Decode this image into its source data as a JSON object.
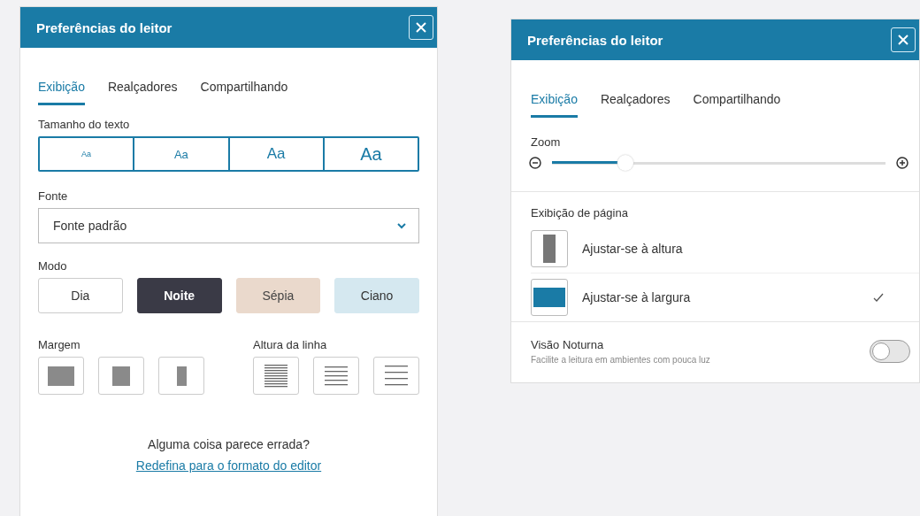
{
  "left_panel": {
    "title": "Preferências do leitor",
    "tabs": [
      {
        "label": "Exibição",
        "selected": true
      },
      {
        "label": "Realçadores",
        "selected": false
      },
      {
        "label": "Compartilhando",
        "selected": false
      }
    ],
    "text_size": {
      "label": "Tamanho do texto",
      "options": [
        {
          "label": "Aa"
        },
        {
          "label": "Aa"
        },
        {
          "label": "Aa"
        },
        {
          "label": "Aa"
        }
      ]
    },
    "font": {
      "label": "Fonte",
      "value": "Fonte padrão"
    },
    "mode": {
      "label": "Modo",
      "options": [
        {
          "label": "Dia",
          "kind": "day"
        },
        {
          "label": "Noite",
          "kind": "night"
        },
        {
          "label": "Sépia",
          "kind": "sepia"
        },
        {
          "label": "Ciano",
          "kind": "cyan"
        }
      ]
    },
    "margin": {
      "label": "Margem",
      "options": [
        {
          "kind": "wide"
        },
        {
          "kind": "medium"
        },
        {
          "kind": "narrow"
        }
      ]
    },
    "line_height": {
      "label": "Altura da linha",
      "options": [
        {
          "kind": "tight"
        },
        {
          "kind": "medium"
        },
        {
          "kind": "loose"
        }
      ]
    },
    "footer": {
      "question": "Alguma coisa parece errada?",
      "link": "Redefina para o formato do editor"
    }
  },
  "right_panel": {
    "title": "Preferências do leitor",
    "tabs": [
      {
        "label": "Exibição",
        "selected": true
      },
      {
        "label": "Realçadores",
        "selected": false
      },
      {
        "label": "Compartilhando",
        "selected": false
      }
    ],
    "zoom": {
      "label": "Zoom",
      "level": 0.22
    },
    "page_view": {
      "label": "Exibição de página",
      "options": [
        {
          "label": "Ajustar-se à altura",
          "kind": "fit-height",
          "selected": false
        },
        {
          "label": "Ajustar-se à largura",
          "kind": "fit-width",
          "selected": true
        }
      ]
    },
    "night_vision": {
      "title": "Visão Noturna",
      "description": "Facilite a leitura em ambientes com pouca luz",
      "on": false
    }
  }
}
